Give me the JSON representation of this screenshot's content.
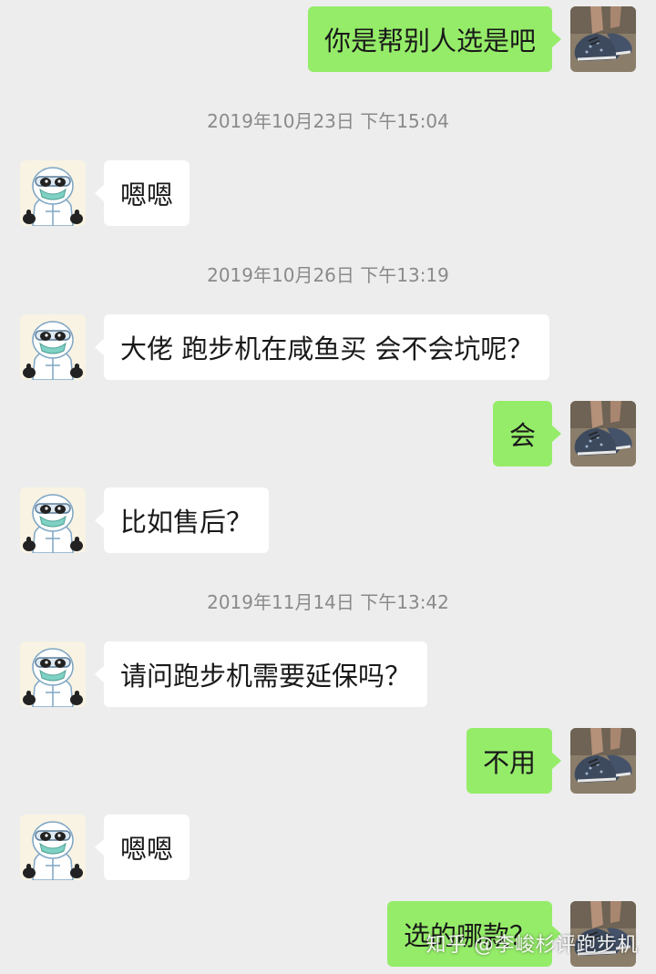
{
  "colors": {
    "background": "#ededed",
    "sent_bubble": "#95ec69",
    "received_bubble": "#ffffff",
    "timestamp_text": "#8a8a8a"
  },
  "contact_avatar_icon": "panda-in-protective-suit-avatar",
  "self_avatar_icon": "sneaker-photo-avatar",
  "timestamps": [
    "2019年10月23日 下午15:04",
    "2019年10月26日 下午13:19",
    "2019年11月14日 下午13:42"
  ],
  "messages": [
    {
      "side": "right",
      "text": "你是帮别人选是吧"
    },
    {
      "side": "left",
      "text": "嗯嗯"
    },
    {
      "side": "left",
      "text": "大佬 跑步机在咸鱼买 会不会坑呢？"
    },
    {
      "side": "right",
      "text": "会"
    },
    {
      "side": "left",
      "text": "比如售后？"
    },
    {
      "side": "left",
      "text": "请问跑步机需要延保吗？"
    },
    {
      "side": "right",
      "text": "不用"
    },
    {
      "side": "left",
      "text": "嗯嗯"
    },
    {
      "side": "right",
      "text": "选的哪款？"
    }
  ],
  "watermark": "知乎 @李峻杉评跑步机"
}
